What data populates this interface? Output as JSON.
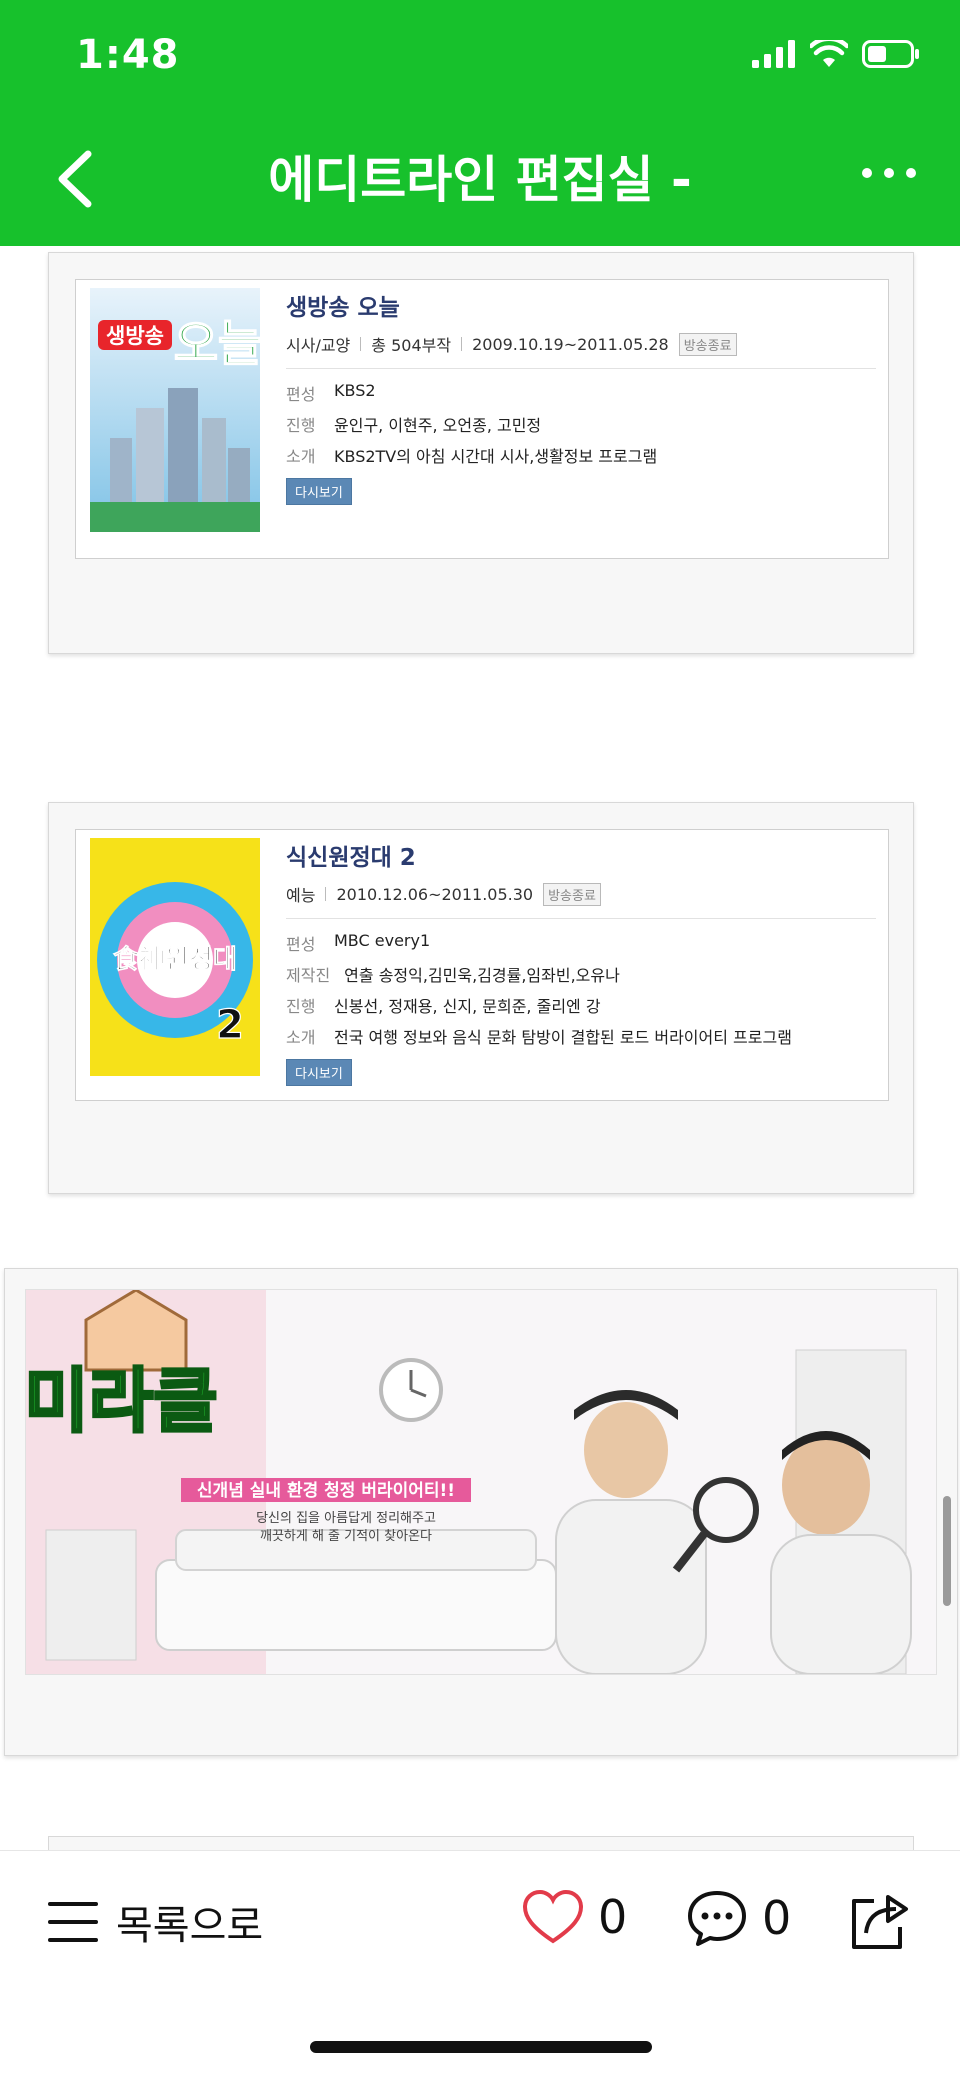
{
  "status_bar": {
    "time": "1:48"
  },
  "nav": {
    "title": "에디트라인 편집실 -"
  },
  "cards": [
    {
      "title": "생방송 오늘",
      "meta": {
        "genre": "시사/교양",
        "episodes": "총 504부작",
        "period": "2009.10.19~2011.05.28",
        "status": "방송종료"
      },
      "rows": [
        {
          "key": "편성",
          "value": "KBS2"
        },
        {
          "key": "진행",
          "value": "윤인구, 이현주, 오언종, 고민정"
        },
        {
          "key": "소개",
          "value": "KBS2TV의 아침 시간대 시사,생활정보 프로그램"
        }
      ],
      "replay_label": "다시보기",
      "thumb_text_top": "생방송",
      "thumb_text_bottom": "오늘"
    },
    {
      "title": "식신원정대 2",
      "meta": {
        "genre": "예능",
        "period": "2010.12.06~2011.05.30",
        "status": "방송종료"
      },
      "rows": [
        {
          "key": "편성",
          "value": "MBC every1"
        },
        {
          "key": "제작진",
          "value": "연출 송정익,김민욱,김경률,임좌빈,오유나"
        },
        {
          "key": "진행",
          "value": "신봉선, 정재용, 신지, 문희준, 줄리엔 강"
        },
        {
          "key": "소개",
          "value": "전국 여행 정보와 음식 문화 탐방이 결합된 로드 버라이어티 프로그램"
        }
      ],
      "replay_label": "다시보기",
      "thumb_text": "食神원정대",
      "thumb_number": "2"
    }
  ],
  "banner": {
    "logo": "미라클",
    "headline": "신개념 실내 환경 청정 버라이어티!!",
    "subline1": "당신의 집을 아름답게 정리해주고",
    "subline2": "깨끗하게 해 줄 기적이 찾아온다"
  },
  "bottom_bar": {
    "list_label": "목록으로",
    "like_count": "0",
    "comment_count": "0"
  },
  "colors": {
    "brand_green": "#17c12c",
    "title_navy": "#2a3b6f",
    "replay_blue": "#5b88b5"
  }
}
